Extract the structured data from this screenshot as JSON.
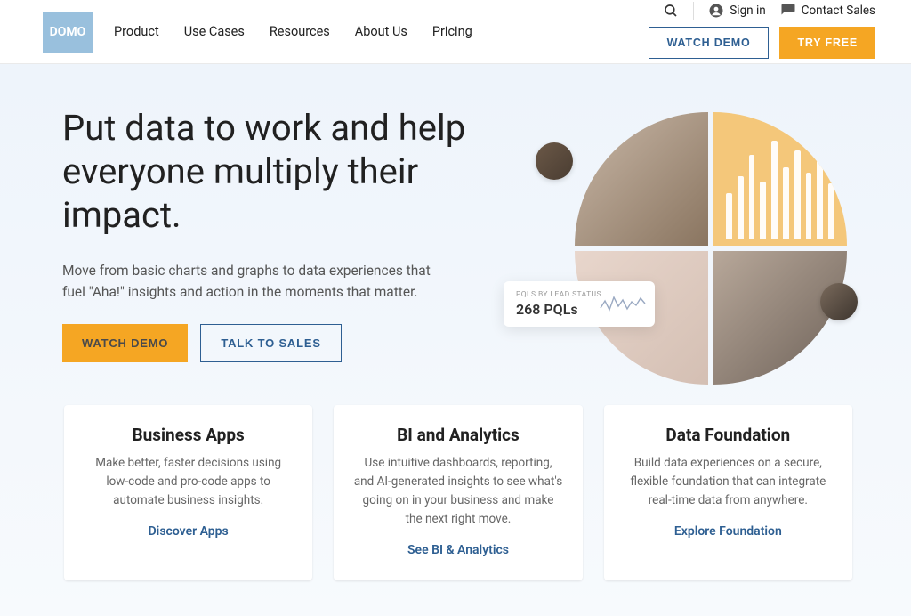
{
  "header": {
    "logo": "DOMO",
    "nav": [
      "Product",
      "Use Cases",
      "Resources",
      "About Us",
      "Pricing"
    ],
    "signin": "Sign in",
    "contact": "Contact Sales",
    "watch_demo": "WATCH DEMO",
    "try_free": "TRY FREE"
  },
  "hero": {
    "title": "Put data to work and help everyone multiply their impact.",
    "subtitle": "Move from basic charts and graphs to data experiences that fuel \"Aha!\" insights and action in the moments that matter.",
    "cta_primary": "WATCH DEMO",
    "cta_secondary": "TALK TO SALES"
  },
  "pql": {
    "label": "PQLS BY LEAD STATUS",
    "value": "268 PQLs"
  },
  "cards": [
    {
      "title": "Business Apps",
      "desc": "Make better, faster decisions using low-code and pro-code apps to automate business insights.",
      "link": "Discover Apps"
    },
    {
      "title": "BI and Analytics",
      "desc": "Use intuitive dashboards, reporting, and AI-generated insights to see what's going on in your business and make the next right move.",
      "link": "See BI & Analytics"
    },
    {
      "title": "Data Foundation",
      "desc": "Build data experiences on a secure, flexible foundation that can integrate real-time data from anywhere.",
      "link": "Explore Foundation"
    }
  ]
}
